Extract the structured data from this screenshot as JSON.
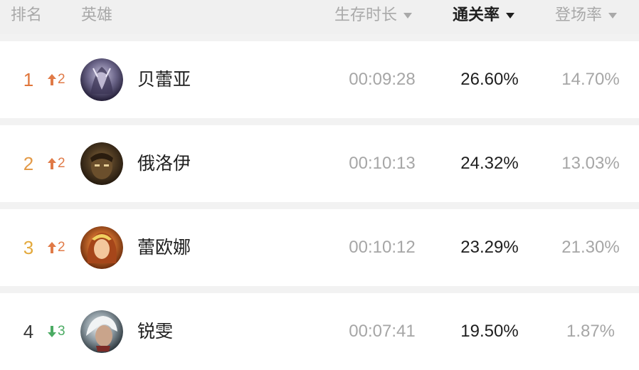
{
  "header": {
    "rank_label": "排名",
    "hero_label": "英雄",
    "survival_label": "生存时长",
    "clear_label": "通关率",
    "pick_label": "登场率",
    "active_sort": "clear"
  },
  "colors": {
    "rank_1": "#e0753a",
    "rank_2": "#e39a47",
    "rank_3": "#e3a93c",
    "rank_other": "#3a3a3a",
    "up": "#e07a47",
    "down": "#4bab63"
  },
  "rows": [
    {
      "rank": "1",
      "direction": "up",
      "change": "2",
      "hero": "贝蕾亚",
      "avatar_icon": "dark-sorceress-avatar",
      "survival": "00:09:28",
      "clear_rate": "26.60%",
      "pick_rate": "14.70%"
    },
    {
      "rank": "2",
      "direction": "up",
      "change": "2",
      "hero": "俄洛伊",
      "avatar_icon": "priestess-avatar",
      "survival": "00:10:13",
      "clear_rate": "24.32%",
      "pick_rate": "13.03%"
    },
    {
      "rank": "3",
      "direction": "up",
      "change": "2",
      "hero": "蕾欧娜",
      "avatar_icon": "sun-warrior-avatar",
      "survival": "00:10:12",
      "clear_rate": "23.29%",
      "pick_rate": "21.30%"
    },
    {
      "rank": "4",
      "direction": "down",
      "change": "3",
      "hero": "锐雯",
      "avatar_icon": "exile-swordswoman-avatar",
      "survival": "00:07:41",
      "clear_rate": "19.50%",
      "pick_rate": "1.87%"
    }
  ]
}
